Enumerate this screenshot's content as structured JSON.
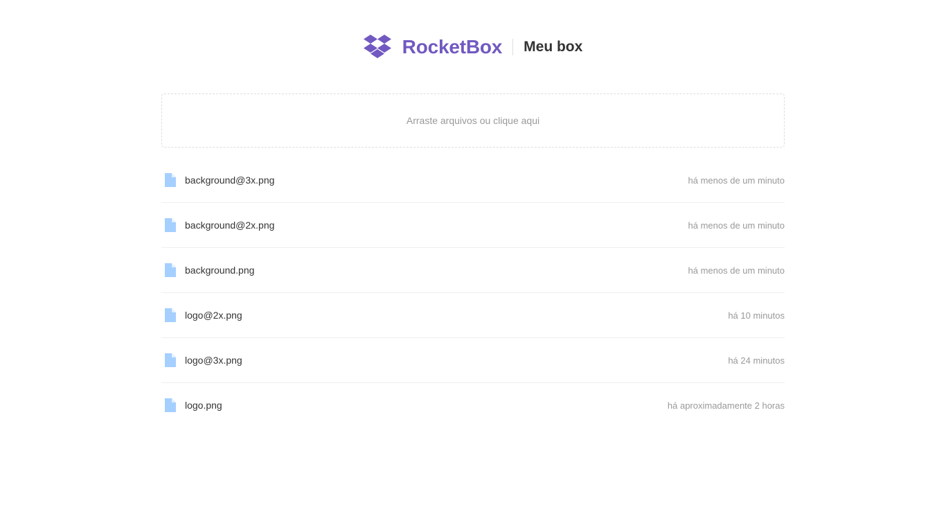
{
  "header": {
    "brand": "RocketBox",
    "box_title": "Meu box",
    "logo_icon": "dropbox-logo-icon",
    "brand_color": "#7159c1"
  },
  "dropzone": {
    "text": "Arraste arquivos ou clique aqui"
  },
  "files": [
    {
      "name": "background@3x.png",
      "date": "há menos de um minuto",
      "icon": "file-icon"
    },
    {
      "name": "background@2x.png",
      "date": "há menos de um minuto",
      "icon": "file-icon"
    },
    {
      "name": "background.png",
      "date": "há menos de um minuto",
      "icon": "file-icon"
    },
    {
      "name": "logo@2x.png",
      "date": "há 10 minutos",
      "icon": "file-icon"
    },
    {
      "name": "logo@3x.png",
      "date": "há 24 minutos",
      "icon": "file-icon"
    },
    {
      "name": "logo.png",
      "date": "há aproximadamente 2 horas",
      "icon": "file-icon"
    }
  ],
  "colors": {
    "file_icon": "#a5cfff",
    "file_icon_fold": "#e3f0ff",
    "text_muted": "#999999"
  }
}
